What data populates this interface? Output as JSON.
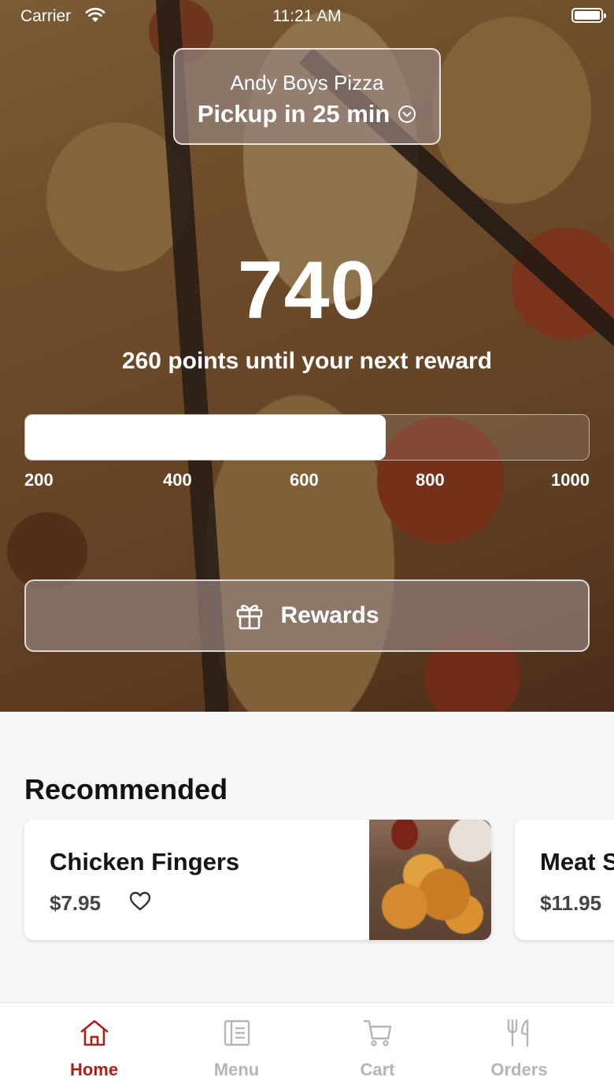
{
  "status_bar": {
    "carrier": "Carrier",
    "time": "11:21 AM"
  },
  "store": {
    "name": "Andy Boys Pizza",
    "pickup": "Pickup in 25 min"
  },
  "points": {
    "value": "740",
    "message": "260 points until your next reward",
    "progress_fraction": 0.64,
    "ticks": [
      "200",
      "400",
      "600",
      "800",
      "1000"
    ]
  },
  "rewards_button": {
    "label": "Rewards",
    "icon": "gift-icon"
  },
  "recommended": {
    "title": "Recommended",
    "items": [
      {
        "name": "Chicken Fingers",
        "price": "$7.95",
        "favorite": false
      },
      {
        "name": "Meat S",
        "price": "$11.95"
      }
    ]
  },
  "tabs": [
    {
      "label": "Home",
      "icon": "home-icon",
      "active": true
    },
    {
      "label": "Menu",
      "icon": "menu-icon",
      "active": false
    },
    {
      "label": "Cart",
      "icon": "cart-icon",
      "active": false
    },
    {
      "label": "Orders",
      "icon": "orders-icon",
      "active": false
    }
  ],
  "colors": {
    "accent": "#a8221b",
    "inactive_tab": "#b5b5b5"
  }
}
